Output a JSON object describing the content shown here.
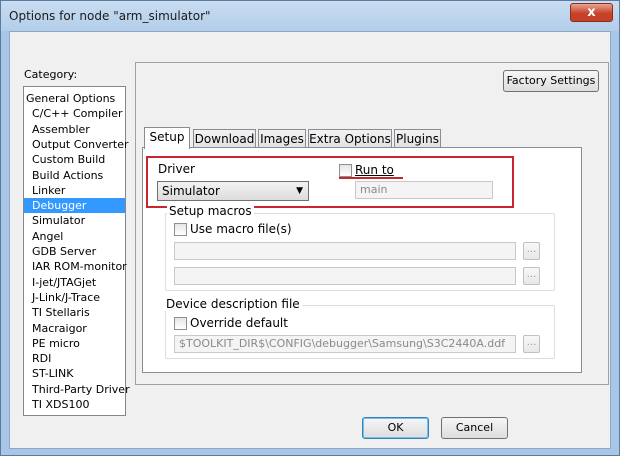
{
  "window": {
    "title": "Options for node \"arm_simulator\"",
    "close_glyph": "x"
  },
  "category": {
    "label": "Category:",
    "items": [
      {
        "label": "General Options",
        "indent": false,
        "selected": false
      },
      {
        "label": "C/C++ Compiler",
        "indent": true,
        "selected": false
      },
      {
        "label": "Assembler",
        "indent": true,
        "selected": false
      },
      {
        "label": "Output Converter",
        "indent": true,
        "selected": false
      },
      {
        "label": "Custom Build",
        "indent": true,
        "selected": false
      },
      {
        "label": "Build Actions",
        "indent": true,
        "selected": false
      },
      {
        "label": "Linker",
        "indent": true,
        "selected": false
      },
      {
        "label": "Debugger",
        "indent": true,
        "selected": true
      },
      {
        "label": "Simulator",
        "indent": true,
        "selected": false
      },
      {
        "label": "Angel",
        "indent": true,
        "selected": false
      },
      {
        "label": "GDB Server",
        "indent": true,
        "selected": false
      },
      {
        "label": "IAR ROM-monitor",
        "indent": true,
        "selected": false
      },
      {
        "label": "I-jet/JTAGjet",
        "indent": true,
        "selected": false
      },
      {
        "label": "J-Link/J-Trace",
        "indent": true,
        "selected": false
      },
      {
        "label": "TI Stellaris",
        "indent": true,
        "selected": false
      },
      {
        "label": "Macraigor",
        "indent": true,
        "selected": false
      },
      {
        "label": "PE micro",
        "indent": true,
        "selected": false
      },
      {
        "label": "RDI",
        "indent": true,
        "selected": false
      },
      {
        "label": "ST-LINK",
        "indent": true,
        "selected": false
      },
      {
        "label": "Third-Party Driver",
        "indent": true,
        "selected": false
      },
      {
        "label": "TI XDS100",
        "indent": true,
        "selected": false
      }
    ]
  },
  "factory_settings_label": "Factory Settings",
  "tabs": [
    {
      "label": "Setup",
      "active": true
    },
    {
      "label": "Download",
      "active": false
    },
    {
      "label": "Images",
      "active": false
    },
    {
      "label": "Extra Options",
      "active": false
    },
    {
      "label": "Plugins",
      "active": false
    }
  ],
  "setup": {
    "driver_label": "Driver",
    "driver_value": "Simulator",
    "run_to_label": "Run to",
    "run_to_checked": false,
    "run_to_value": "main",
    "macros_title": "Setup macros",
    "use_macro_label": "Use macro file(s)",
    "use_macro_checked": false,
    "macro_field_1": "",
    "macro_field_2": "",
    "device_title": "Device description file",
    "override_label": "Override default",
    "override_checked": false,
    "device_path": "$TOOLKIT_DIR$\\CONFIG\\debugger\\Samsung\\S3C2440A.ddf",
    "browse_glyph": "..."
  },
  "buttons": {
    "ok_label": "OK",
    "cancel_label": "Cancel"
  },
  "colors": {
    "highlight": "#c8262c",
    "selection": "#3399ff"
  }
}
